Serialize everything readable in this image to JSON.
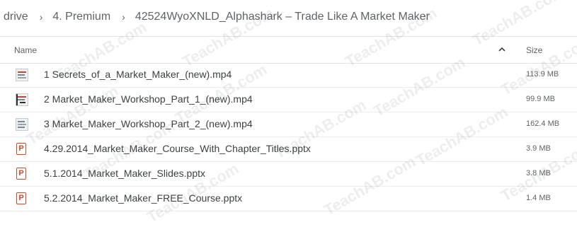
{
  "breadcrumb": {
    "items": [
      "l drive",
      "4. Premium",
      "42524WyoXNLD_Alphashark – Trade Like A Market Maker"
    ],
    "separator": "›"
  },
  "columns": {
    "name": "Name",
    "size": "Size",
    "sort_icon": "chevron-up-icon"
  },
  "files": [
    {
      "name": "1 Secrets_of_a_Market_Maker_(new).mp4",
      "size": "113.9 MB",
      "icon": "video-icon"
    },
    {
      "name": "2 Market_Maker_Workshop_Part_1_(new).mp4",
      "size": "99.9 MB",
      "icon": "video-icon"
    },
    {
      "name": "3 Market_Maker_Workshop_Part_2_(new).mp4",
      "size": "162.4 MB",
      "icon": "video-icon"
    },
    {
      "name": "4.29.2014_Market_Maker_Course_With_Chapter_Titles.pptx",
      "size": "3.9 MB",
      "icon": "powerpoint-icon"
    },
    {
      "name": "5.1.2014_Market_Maker_Slides.pptx",
      "size": "3.8 MB",
      "icon": "powerpoint-icon"
    },
    {
      "name": "5.2.2014_Market_Maker_FREE_Course.pptx",
      "size": "1.4 MB",
      "icon": "powerpoint-icon"
    }
  ],
  "ppt_letter": "P",
  "watermark": "TeachAB.com",
  "colors": {
    "powerpoint": "#d24726",
    "text": "#3c4043",
    "muted": "#5f6368"
  }
}
